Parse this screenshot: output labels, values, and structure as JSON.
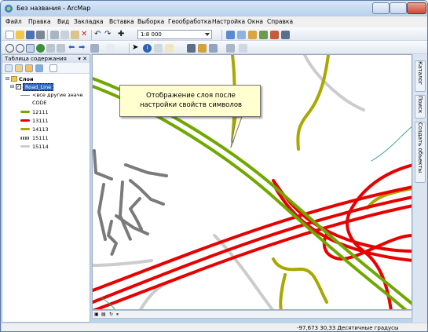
{
  "window": {
    "title": "Без названия - ArcMap"
  },
  "menu": [
    "Файл",
    "Правка",
    "Вид",
    "Закладка",
    "Вставка",
    "Выборка",
    "Геообработка",
    "Настройка",
    "Окна",
    "Справка"
  ],
  "toolbar": {
    "scale_value": "1:8 000"
  },
  "toc": {
    "title": "Таблица содержания",
    "pin_close": "▾ ✕",
    "layers_group": "Слои",
    "layer_name": "Road_Line",
    "other_values": "<все другие значе",
    "field": "CODE",
    "classes": [
      {
        "label": "12111",
        "color": "#70a800"
      },
      {
        "label": "13111",
        "color": "#e60000"
      },
      {
        "label": "14113",
        "color": "#a8a800"
      },
      {
        "label": "15111",
        "color": "#686868"
      },
      {
        "label": "15114",
        "color": "#cccccc"
      }
    ]
  },
  "callout": {
    "text": "Отображение слоя после\nнастройки свойств символов"
  },
  "right_tabs": [
    "Каталог",
    "Поиск",
    "Создать объекты"
  ],
  "status": {
    "coords": "-97,673  30,33 Десятичные градусы"
  },
  "colors": {
    "green": "#70a800",
    "red": "#e60000",
    "olive": "#a8a800",
    "gray": "#cccccc",
    "darkgray": "#686868",
    "teal": "#3aa38b"
  }
}
